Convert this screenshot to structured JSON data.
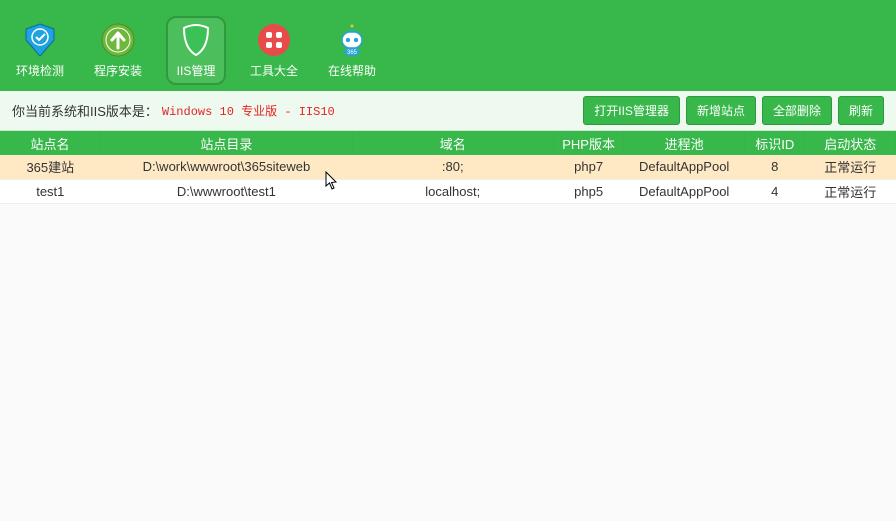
{
  "toolbar": [
    {
      "key": "env",
      "label": "环境检测",
      "icon": "shield-badge",
      "selected": false
    },
    {
      "key": "inst",
      "label": "程序安装",
      "icon": "arrow-up",
      "selected": false
    },
    {
      "key": "iis",
      "label": "IIS管理",
      "icon": "shield",
      "selected": true
    },
    {
      "key": "tools",
      "label": "工具大全",
      "icon": "grid4",
      "selected": false
    },
    {
      "key": "help",
      "label": "在线帮助",
      "icon": "robot",
      "selected": false
    }
  ],
  "infobar": {
    "prefix": "你当前系统和IIS版本是：",
    "value": "Windows 10 专业版 - IIS10",
    "buttons": [
      "打开IIS管理器",
      "新增站点",
      "全部删除",
      "刷新"
    ]
  },
  "table": {
    "headers": [
      "站点名",
      "站点目录",
      "域名",
      "PHP版本",
      "进程池",
      "标识ID",
      "启动状态"
    ],
    "rows": [
      {
        "name": "365建站",
        "dir": "D:\\work\\wwwroot\\365siteweb",
        "domain": ":80;",
        "php": "php7",
        "pool": "DefaultAppPool",
        "id": "8",
        "status": "正常运行",
        "selected": true
      },
      {
        "name": "test1",
        "dir": "D:\\wwwroot\\test1",
        "domain": "localhost;",
        "php": "php5",
        "pool": "DefaultAppPool",
        "id": "4",
        "status": "正常运行",
        "selected": false
      }
    ]
  }
}
